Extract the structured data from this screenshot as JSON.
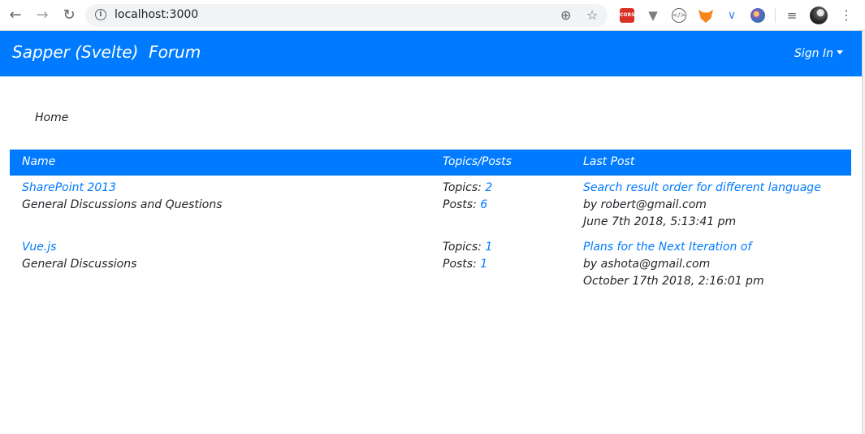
{
  "browser": {
    "url": "localhost:3000"
  },
  "app": {
    "brand": "Sapper (Svelte)  Forum",
    "sign_in_label": "Sign In",
    "breadcrumb": "Home",
    "colors": {
      "primary": "#007bff",
      "link": "#007bff",
      "text": "#212529"
    }
  },
  "table": {
    "headers": {
      "name": "Name",
      "counts": "Topics/Posts",
      "last_post": "Last Post"
    },
    "rows": [
      {
        "forum_name": "SharePoint 2013",
        "description": "General Discussions and Questions",
        "topics_label": "Topics:",
        "topics": "2",
        "posts_label": "Posts:",
        "posts": "6",
        "last_post_title": "Search result order for different language",
        "last_post_by": "by robert@gmail.com",
        "last_post_date": "June 7th 2018, 5:13:41 pm"
      },
      {
        "forum_name": "Vue.js",
        "description": "General Discussions",
        "topics_label": "Topics:",
        "topics": "1",
        "posts_label": "Posts:",
        "posts": "1",
        "last_post_title": "Plans for the Next Iteration of",
        "last_post_by": "by ashota@gmail.com",
        "last_post_date": "October 17th 2018, 2:16:01 pm"
      }
    ]
  }
}
